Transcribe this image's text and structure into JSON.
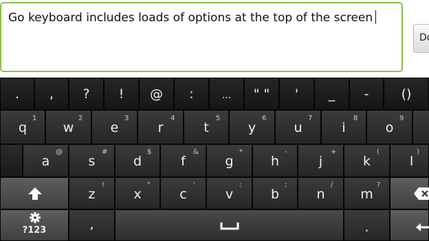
{
  "text_field": {
    "value": "Go keyboard includes loads of options at the top of the screen"
  },
  "done_button": {
    "label": "Do"
  },
  "keyboard": {
    "symbol_row": [
      ".",
      ",",
      "?",
      "!",
      "@",
      ":",
      "...",
      "\" \"",
      "'",
      "_",
      "-",
      "()"
    ],
    "row1": [
      {
        "k": "q",
        "s": "1"
      },
      {
        "k": "w",
        "s": "2"
      },
      {
        "k": "e",
        "s": "3"
      },
      {
        "k": "r",
        "s": "4"
      },
      {
        "k": "t",
        "s": "5"
      },
      {
        "k": "y",
        "s": "6"
      },
      {
        "k": "u",
        "s": "7"
      },
      {
        "k": "i",
        "s": "8"
      },
      {
        "k": "o",
        "s": "9"
      }
    ],
    "row2": [
      {
        "k": "a",
        "s": "@"
      },
      {
        "k": "s",
        "s": "#"
      },
      {
        "k": "d",
        "s": "$"
      },
      {
        "k": "f",
        "s": "&"
      },
      {
        "k": "g",
        "s": "*"
      },
      {
        "k": "h",
        "s": "-"
      },
      {
        "k": "j",
        "s": "+"
      },
      {
        "k": "k",
        "s": "("
      },
      {
        "k": "l",
        "s": ")"
      }
    ],
    "row3": [
      {
        "k": "z",
        "s": "!"
      },
      {
        "k": "x",
        "s": "\""
      },
      {
        "k": "c",
        "s": "'"
      },
      {
        "k": "v",
        "s": ":"
      },
      {
        "k": "b",
        "s": ";"
      },
      {
        "k": "n",
        "s": "/"
      },
      {
        "k": "m",
        "s": "?"
      }
    ],
    "shift_icon": "up-arrow-icon",
    "backspace_icon": "backspace-icon",
    "settings_icon": "gear-icon",
    "symbols_label": "?123",
    "comma_label": ",",
    "space_icon": "space-bar-icon",
    "period_label": ".",
    "enter_icon": "enter-arrow-icon"
  }
}
